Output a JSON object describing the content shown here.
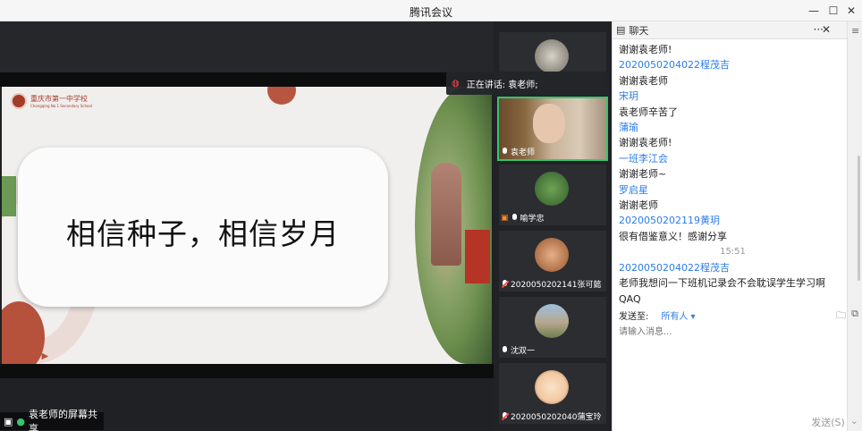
{
  "window": {
    "title": "腾讯会议"
  },
  "controls": {
    "min": "—",
    "max": "☐",
    "close": "✕"
  },
  "stage": {
    "school_name": "重庆市第一中学校",
    "school_en": "Chongqing No.1 Secondary School",
    "slide_quote": "相信种子，相信岁月",
    "share_label": "袁老师的屏幕共享",
    "speaking_label": "正在讲话: 袁老师;"
  },
  "participants": [
    {
      "name": "",
      "muted": false
    },
    {
      "name": "袁老师",
      "muted": false,
      "active": true
    },
    {
      "name": "喻学忠",
      "muted": false
    },
    {
      "name": "2020050202141张可懿",
      "muted": true
    },
    {
      "name": "沈双一",
      "muted": false
    },
    {
      "name": "2020050202040蒲宝玲",
      "muted": true
    }
  ],
  "chat": {
    "title": "聊天",
    "more": "···",
    "close": "✕",
    "messages": [
      {
        "type": "text",
        "value": "谢谢袁老师!"
      },
      {
        "type": "sender",
        "value": "2020050204022程茂吉"
      },
      {
        "type": "text",
        "value": "谢谢袁老师"
      },
      {
        "type": "sender",
        "value": "宋玥"
      },
      {
        "type": "text",
        "value": "袁老师辛苦了"
      },
      {
        "type": "sender",
        "value": "蒲瑜"
      },
      {
        "type": "text",
        "value": "谢谢袁老师!"
      },
      {
        "type": "sender",
        "value": "一班李江会"
      },
      {
        "type": "text",
        "value": "谢谢老师~"
      },
      {
        "type": "sender",
        "value": "罗启星"
      },
      {
        "type": "text",
        "value": "谢谢老师"
      },
      {
        "type": "sender",
        "value": "2020050202119黄玥"
      },
      {
        "type": "text",
        "value": "很有借鉴意义！感谢分享"
      },
      {
        "type": "time",
        "value": "15:51"
      },
      {
        "type": "sender",
        "value": "2020050204022程茂吉"
      },
      {
        "type": "text",
        "value": "老师我想问一下班机记录会不会耽误学生学习啊QAQ"
      }
    ],
    "send_to_label": "发送至:",
    "send_to_target": "所有人 ▾",
    "input_placeholder": "请输入消息...",
    "send_button": "发送(S)",
    "send_dropdown": "⌄"
  }
}
